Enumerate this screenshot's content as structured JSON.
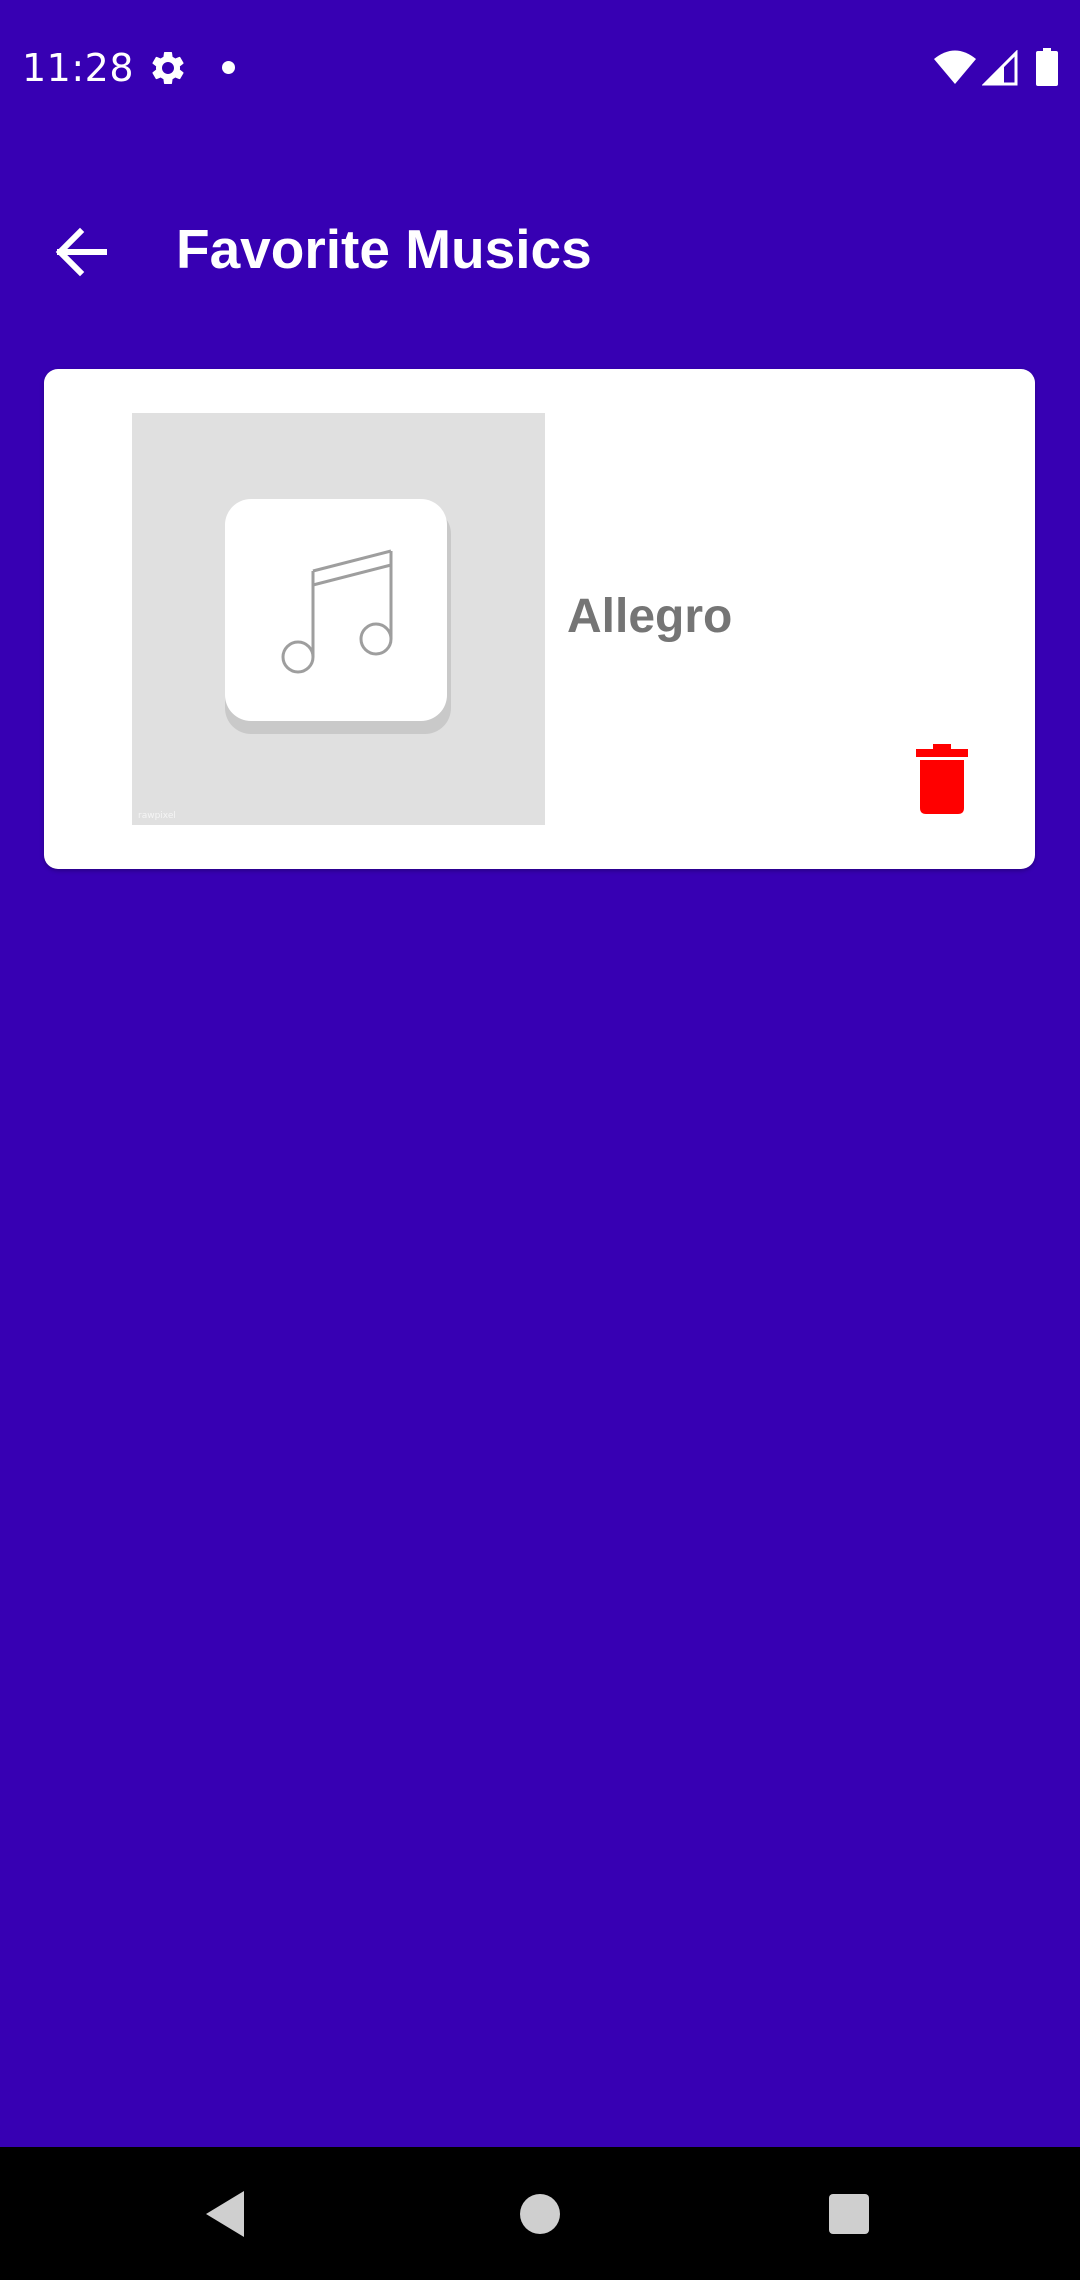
{
  "status_bar": {
    "time": "11:28",
    "icons": [
      "gear-icon",
      "notification-dot-icon",
      "wifi-icon",
      "cell-signal-icon",
      "battery-icon"
    ]
  },
  "app_bar": {
    "back_icon": "arrow-left-icon",
    "title": "Favorite Musics"
  },
  "favorites": [
    {
      "title": "Allegro",
      "art_icon": "music-note-icon",
      "art_watermark": "rawpixel",
      "delete_icon": "trash-icon"
    }
  ],
  "nav_bar": {
    "icons": [
      "nav-back-icon",
      "nav-home-icon",
      "nav-recents-icon"
    ]
  },
  "colors": {
    "background": "#3700b3",
    "card": "#ffffff",
    "title_text": "#ffffff",
    "song_text": "#757575",
    "delete": "#ff0000",
    "art_background": "#e0e0e0"
  }
}
